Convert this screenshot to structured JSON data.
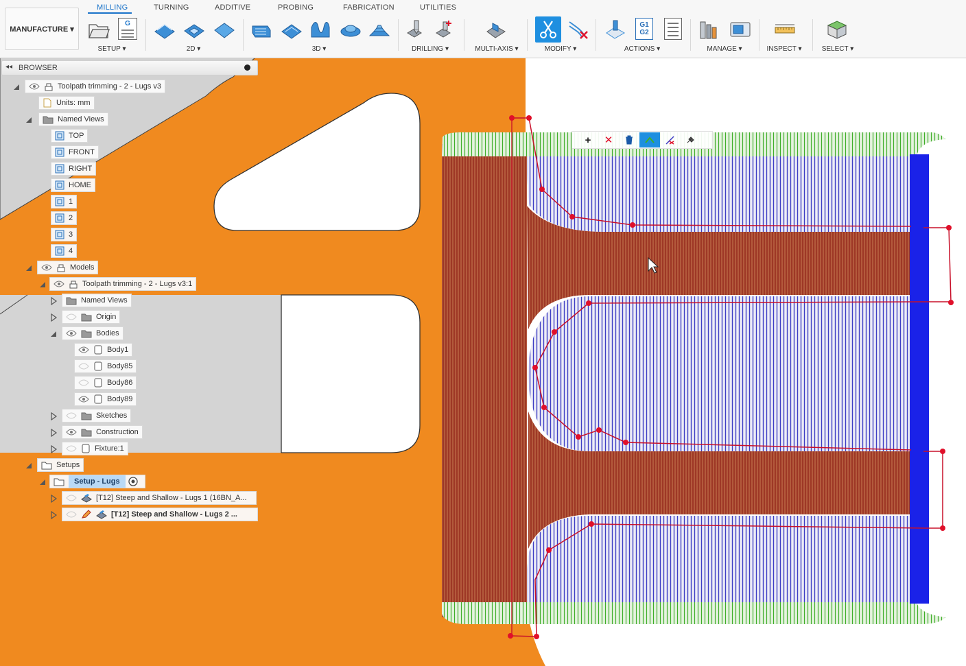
{
  "workspace": {
    "label": "MANUFACTURE ▾"
  },
  "tabs": [
    {
      "label": "MILLING",
      "active": true
    },
    {
      "label": "TURNING"
    },
    {
      "label": "ADDITIVE"
    },
    {
      "label": "PROBING"
    },
    {
      "label": "FABRICATION"
    },
    {
      "label": "UTILITIES"
    }
  ],
  "groups": {
    "setup": "SETUP ▾",
    "g2d": "2D ▾",
    "g3d": "3D ▾",
    "drilling": "DRILLING ▾",
    "multiaxis": "MULTI-AXIS ▾",
    "modify": "MODIFY ▾",
    "actions": "ACTIONS ▾",
    "manage": "MANAGE ▾",
    "inspect": "INSPECT ▾",
    "select": "SELECT ▾"
  },
  "toolbar_icons": {
    "nc_program_text": "G",
    "g1g2_text": "G1\nG2"
  },
  "browser": {
    "title": "BROWSER",
    "root": "Toolpath trimming - 2 - Lugs v3",
    "units": "Units: mm",
    "named_views": "Named Views",
    "views": [
      "TOP",
      "FRONT",
      "RIGHT",
      "HOME",
      "1",
      "2",
      "3",
      "4"
    ],
    "models": "Models",
    "model_component": "Toolpath trimming - 2 - Lugs v3:1",
    "comp_named_views": "Named Views",
    "origin": "Origin",
    "bodies": "Bodies",
    "body_list": [
      "Body1",
      "Body85",
      "Body86",
      "Body89"
    ],
    "sketches": "Sketches",
    "construction": "Construction",
    "fixture": "Fixture:1",
    "setups": "Setups",
    "setup_name": "Setup - Lugs",
    "op1": "[T12] Steep and Shallow - Lugs 1 (16BN_A...",
    "op2": "[T12] Steep and Shallow - Lugs 2 ..."
  },
  "colors": {
    "accent": "#1a73c9",
    "part_orange": "#f08a1f",
    "toolpath_blue": "#3232c8",
    "toolpath_red": "#c03020",
    "toolpath_green": "#3fae2a",
    "trim_point": "#e0102a"
  },
  "mini_toolbar": [
    "+",
    "✕"
  ]
}
